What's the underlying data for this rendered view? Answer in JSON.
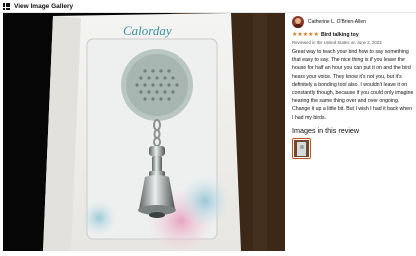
{
  "header": {
    "title": "View Image Gallery",
    "icon": "grid-icon"
  },
  "photo": {
    "brand": "Calorday",
    "subject": "bird-talking-toy-in-box"
  },
  "review": {
    "reviewer": "Catherine L. O'Brien-Allen",
    "rating": 5,
    "rating_color": "#de7921",
    "title": "Bird talking toy",
    "meta": "Reviewed in the United States on June 2, 2023",
    "body": "Great way to teach your bird how to say something that easy to say. The nice thing is if you leave the house for half an hour you can put it on and the bird hears your voice. They know it's not you, but it's definitely a bonding tool also. I wouldn't leave it on constantly though, because if you could only imagine hearing the same thing over and over ongoing. Change it up a little bit. But I wish I had it back when I had my birds.",
    "images_heading": "Images in this review"
  },
  "colors": {
    "thumb_border": "#c7511f",
    "text": "#0f1111",
    "meta": "#565959"
  }
}
